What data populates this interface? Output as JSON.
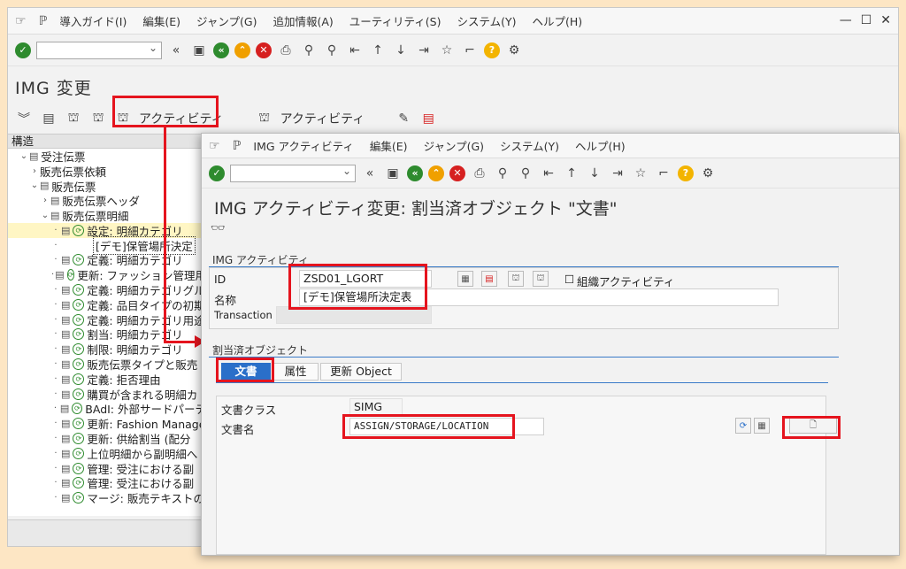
{
  "main": {
    "menu": [
      "導入ガイド(I)",
      "編集(E)",
      "ジャンプ(G)",
      "追加情報(A)",
      "ユーティリティ(S)",
      "システム(Y)",
      "ヘルプ(H)"
    ],
    "title": "IMG 変更",
    "app_toolbar": {
      "activity1": "アクティビティ",
      "activity2": "アクティビティ"
    },
    "structure_header": "構造",
    "tree": [
      {
        "indent": 1,
        "toggle": "⌄",
        "icon": "doc",
        "text": "受注伝票"
      },
      {
        "indent": 2,
        "toggle": "›",
        "icon": "none",
        "text": "販売伝票依頼"
      },
      {
        "indent": 2,
        "toggle": "⌄",
        "icon": "doc",
        "text": "販売伝票"
      },
      {
        "indent": 3,
        "toggle": "›",
        "icon": "doc",
        "text": "販売伝票ヘッダ"
      },
      {
        "indent": 3,
        "toggle": "⌄",
        "icon": "doc",
        "text": "販売伝票明細"
      },
      {
        "indent": 4,
        "toggle": "·",
        "icon": "clock",
        "text": "設定: 明細カテゴリ",
        "hl": true
      },
      {
        "indent": 4,
        "toggle": "·",
        "icon": "none",
        "text": "[デモ]保管場所決定",
        "boxed": true
      },
      {
        "indent": 4,
        "toggle": "·",
        "icon": "clock",
        "text": "定義: 明細カテゴリ"
      },
      {
        "indent": 4,
        "toggle": "·",
        "icon": "clock",
        "text": "更新: ファッション管理用"
      },
      {
        "indent": 4,
        "toggle": "·",
        "icon": "clock",
        "text": "定義: 明細カテゴリグル"
      },
      {
        "indent": 4,
        "toggle": "·",
        "icon": "clock",
        "text": "定義: 品目タイプの初期"
      },
      {
        "indent": 4,
        "toggle": "·",
        "icon": "clock",
        "text": "定義: 明細カテゴリ用途"
      },
      {
        "indent": 4,
        "toggle": "·",
        "icon": "clock",
        "text": "割当: 明細カテゴリ"
      },
      {
        "indent": 4,
        "toggle": "·",
        "icon": "clock",
        "text": "制限: 明細カテゴリ"
      },
      {
        "indent": 4,
        "toggle": "·",
        "icon": "clock",
        "text": "販売伝票タイプと販売"
      },
      {
        "indent": 4,
        "toggle": "·",
        "icon": "clock",
        "text": "定義: 拒否理由"
      },
      {
        "indent": 4,
        "toggle": "·",
        "icon": "clock",
        "text": "購買が含まれる明細カ"
      },
      {
        "indent": 4,
        "toggle": "·",
        "icon": "clock",
        "text": "BAdI: 外部サードパーテ"
      },
      {
        "indent": 4,
        "toggle": "·",
        "icon": "clock",
        "text": "更新: Fashion Manage"
      },
      {
        "indent": 4,
        "toggle": "·",
        "icon": "clock",
        "text": "更新: 供給割当 (配分"
      },
      {
        "indent": 4,
        "toggle": "·",
        "icon": "clock",
        "text": "上位明細から副明細へ"
      },
      {
        "indent": 4,
        "toggle": "·",
        "icon": "clock",
        "text": "管理: 受注における副"
      },
      {
        "indent": 4,
        "toggle": "·",
        "icon": "clock",
        "text": "管理: 受注における副"
      },
      {
        "indent": 4,
        "toggle": "·",
        "icon": "clock",
        "text": "マージ: 販売テキストの"
      }
    ]
  },
  "popup": {
    "menu": [
      "IMG アクティビティ",
      "編集(E)",
      "ジャンプ(G)",
      "システム(Y)",
      "ヘルプ(H)"
    ],
    "title": "IMG アクティビティ変更: 割当済オブジェクト \"文書\"",
    "group1_title": "IMG アクティビティ",
    "id_label": "ID",
    "id_value": "ZSD01_LGORT",
    "name_label": "名称",
    "name_value": "[デモ]保管場所決定表",
    "transaction_label": "Transaction",
    "org_activity_label": "組織アクティビティ",
    "group2_title": "割当済オブジェクト",
    "tabs": [
      "文書",
      "属性",
      "更新 Object"
    ],
    "doc_class_label": "文書クラス",
    "doc_class_value": "SIMG",
    "doc_name_label": "文書名",
    "doc_name_value": "ASSIGN/STORAGE/LOCATION"
  },
  "colors": {
    "highlight_red": "#e5141e",
    "tab_active": "#2a6fc9",
    "background": "#fde6c4"
  }
}
